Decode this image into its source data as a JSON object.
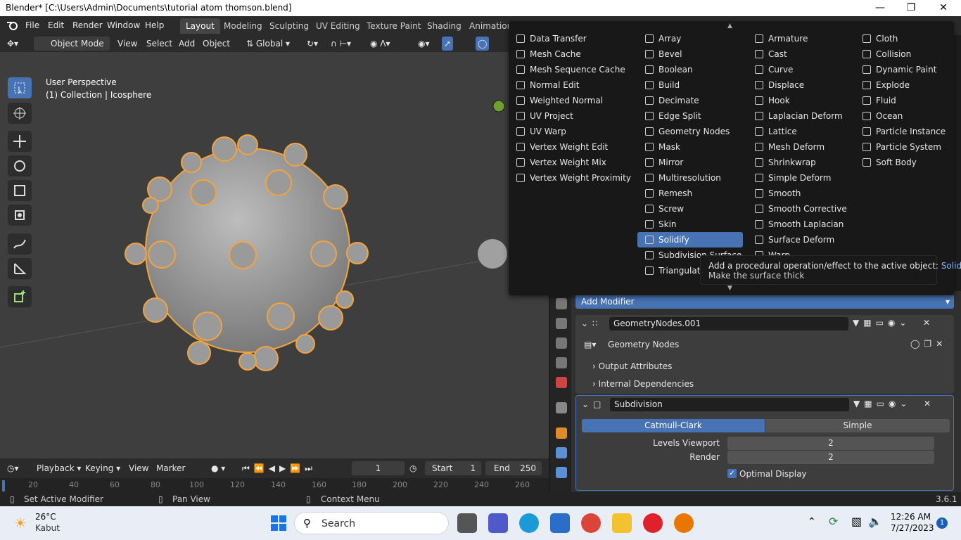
{
  "window": {
    "title": "Blender* [C:\\Users\\Admin\\Documents\\tutorial atom thomson.blend]"
  },
  "menubar": {
    "items": [
      "File",
      "Edit",
      "Render",
      "Window",
      "Help"
    ]
  },
  "workspaces": {
    "tabs": [
      "Layout",
      "Modeling",
      "Sculpting",
      "UV Editing",
      "Texture Paint",
      "Shading",
      "Animation"
    ],
    "active": "Layout"
  },
  "header3d": {
    "mode": "Object Mode",
    "menus": [
      "View",
      "Select",
      "Add",
      "Object"
    ],
    "orientation": "Global"
  },
  "viewport": {
    "perspective": "User Perspective",
    "collection": "(1) Collection | Icosphere"
  },
  "timeline": {
    "menus": [
      "Playback",
      "Keying",
      "View",
      "Marker"
    ],
    "current_frame": "1",
    "start_label": "Start",
    "start": "1",
    "end_label": "End",
    "end": "250",
    "ruler": [
      "20",
      "40",
      "60",
      "80",
      "100",
      "120",
      "140",
      "160",
      "180",
      "200",
      "220",
      "240",
      "260"
    ]
  },
  "statusbar": {
    "left": "Set Active Modifier",
    "middle": "Pan View",
    "right": "Context Menu",
    "version": "3.6.1"
  },
  "properties": {
    "add_modifier": "Add Modifier",
    "modifiers": [
      {
        "name": "GeometryNodes.001",
        "node_group": "Geometry Nodes",
        "sections": [
          "Output Attributes",
          "Internal Dependencies"
        ]
      },
      {
        "name": "Subdivision",
        "tabs": [
          "Catmull-Clark",
          "Simple"
        ],
        "levels_viewport_label": "Levels Viewport",
        "levels_viewport": "2",
        "render_label": "Render",
        "render": "2",
        "optimal_display": "Optimal Display"
      }
    ]
  },
  "modifier_menu": {
    "columns": [
      [
        "Data Transfer",
        "Mesh Cache",
        "Mesh Sequence Cache",
        "Normal Edit",
        "Weighted Normal",
        "UV Project",
        "UV Warp",
        "Vertex Weight Edit",
        "Vertex Weight Mix",
        "Vertex Weight Proximity"
      ],
      [
        "Array",
        "Bevel",
        "Boolean",
        "Build",
        "Decimate",
        "Edge Split",
        "Geometry Nodes",
        "Mask",
        "Mirror",
        "Multiresolution",
        "Remesh",
        "Screw",
        "Skin",
        "Solidify",
        "Subdivision Surface",
        "Triangulate"
      ],
      [
        "Armature",
        "Cast",
        "Curve",
        "Displace",
        "Hook",
        "Laplacian Deform",
        "Lattice",
        "Mesh Deform",
        "Shrinkwrap",
        "Simple Deform",
        "Smooth",
        "Smooth Corrective",
        "Smooth Laplacian",
        "Surface Deform",
        "Warp"
      ],
      [
        "Cloth",
        "Collision",
        "Dynamic Paint",
        "Explode",
        "Fluid",
        "Ocean",
        "Particle Instance",
        "Particle System",
        "Soft Body"
      ]
    ],
    "highlighted": "Solidify"
  },
  "tooltip": {
    "text": "Add a procedural operation/effect to the active object:",
    "op": "Solidify",
    "description": "Make the surface thick"
  },
  "taskbar": {
    "temperature": "26°C",
    "weather": "Kabut",
    "search": "Search",
    "time": "12:26 AM",
    "date": "7/27/2023",
    "notification_count": "1"
  },
  "colors": {
    "accent": "#4772b3",
    "selection": "#f5a33c",
    "bg": "#1d1d1d"
  }
}
